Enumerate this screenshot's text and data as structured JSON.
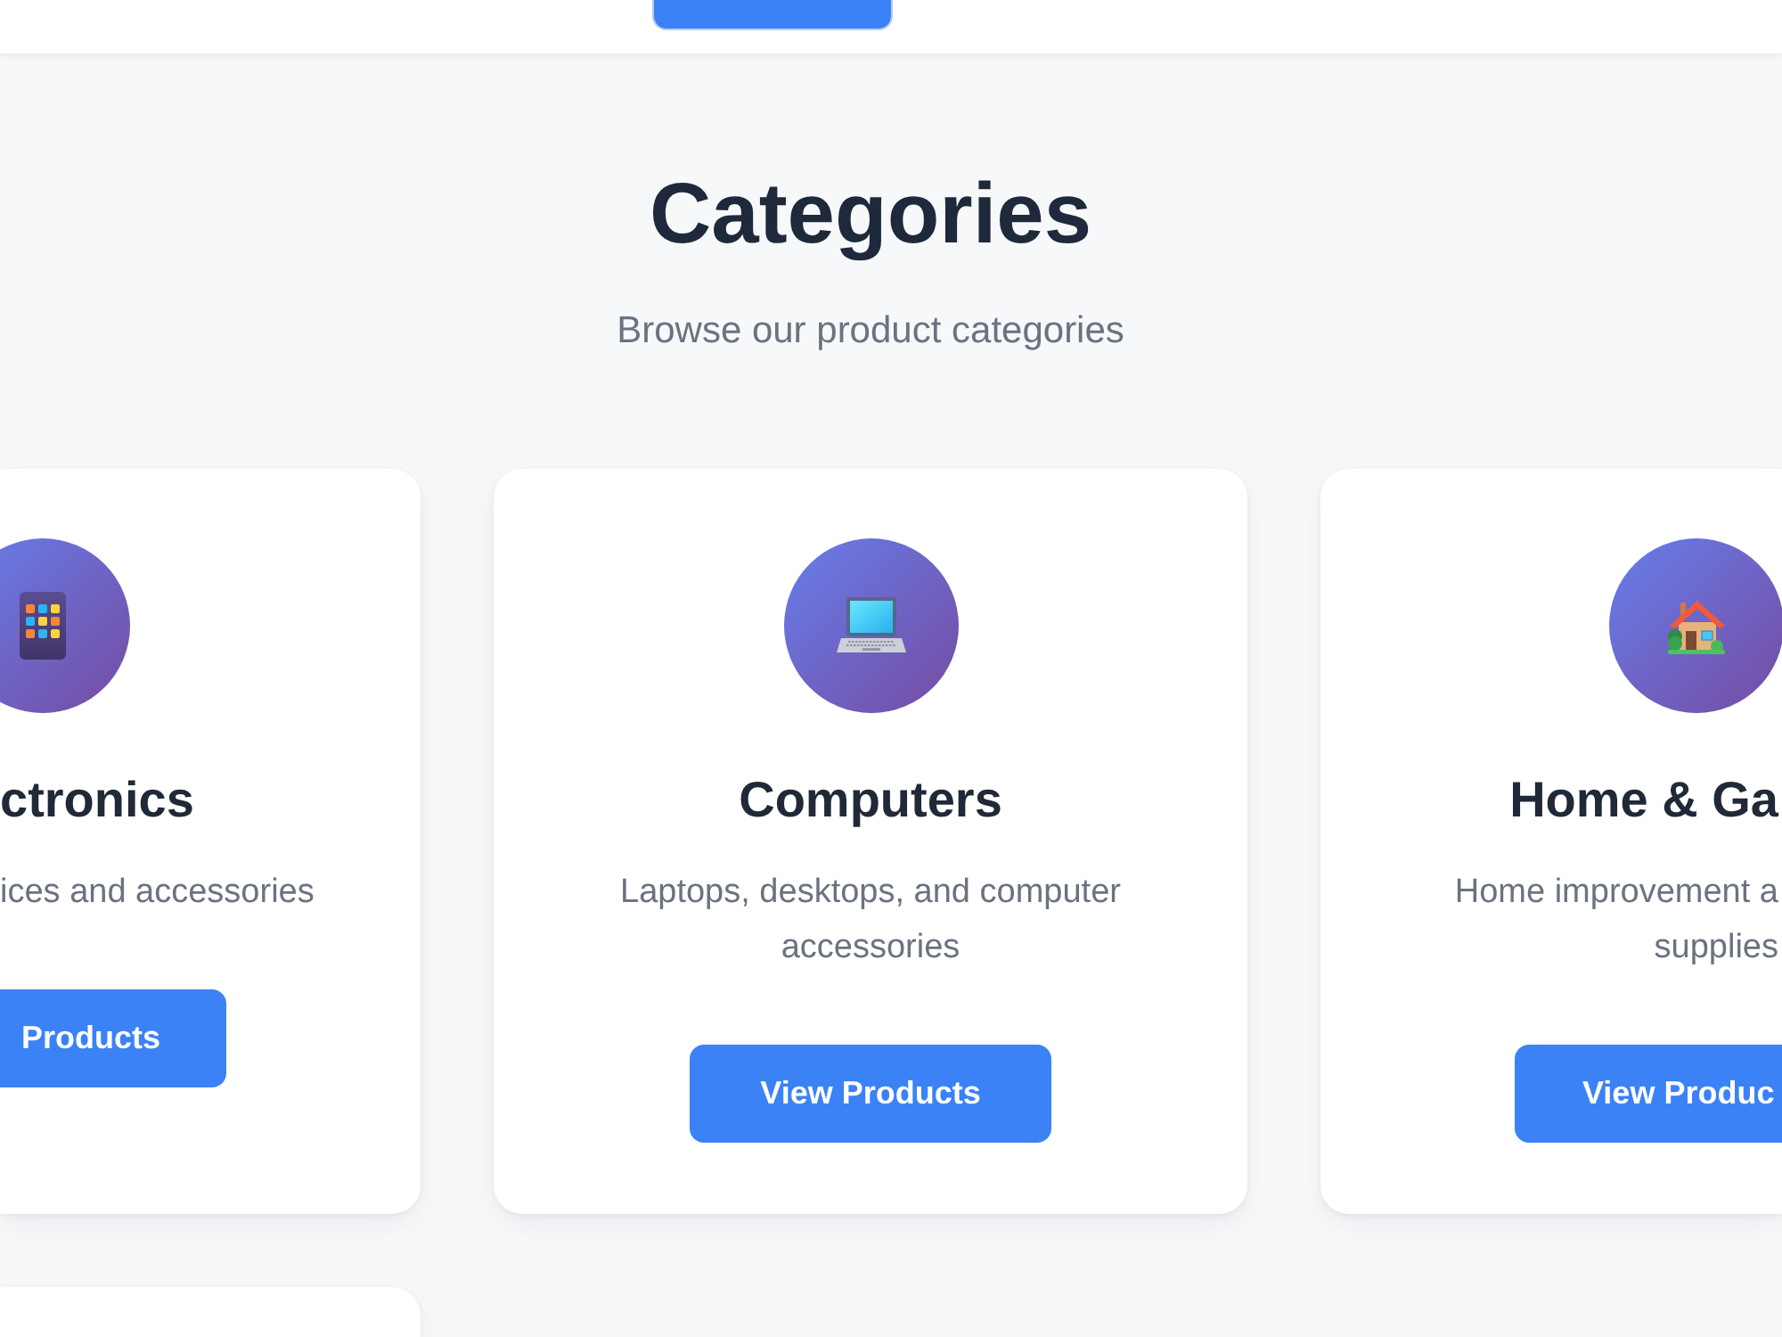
{
  "header": {
    "nav_items": [
      {
        "selected": true
      }
    ]
  },
  "section": {
    "title": "Categories",
    "subtitle": "Browse our product categories"
  },
  "categories": [
    {
      "name": "ctronics",
      "description": "ices and accessories",
      "button": "Products"
    },
    {
      "name": "Computers",
      "description": "Laptops, desktops, and computer accessories",
      "button": "View Products"
    },
    {
      "name": "Home & Ga",
      "description": "Home improvement a supplies",
      "button": "View Produc"
    }
  ]
}
